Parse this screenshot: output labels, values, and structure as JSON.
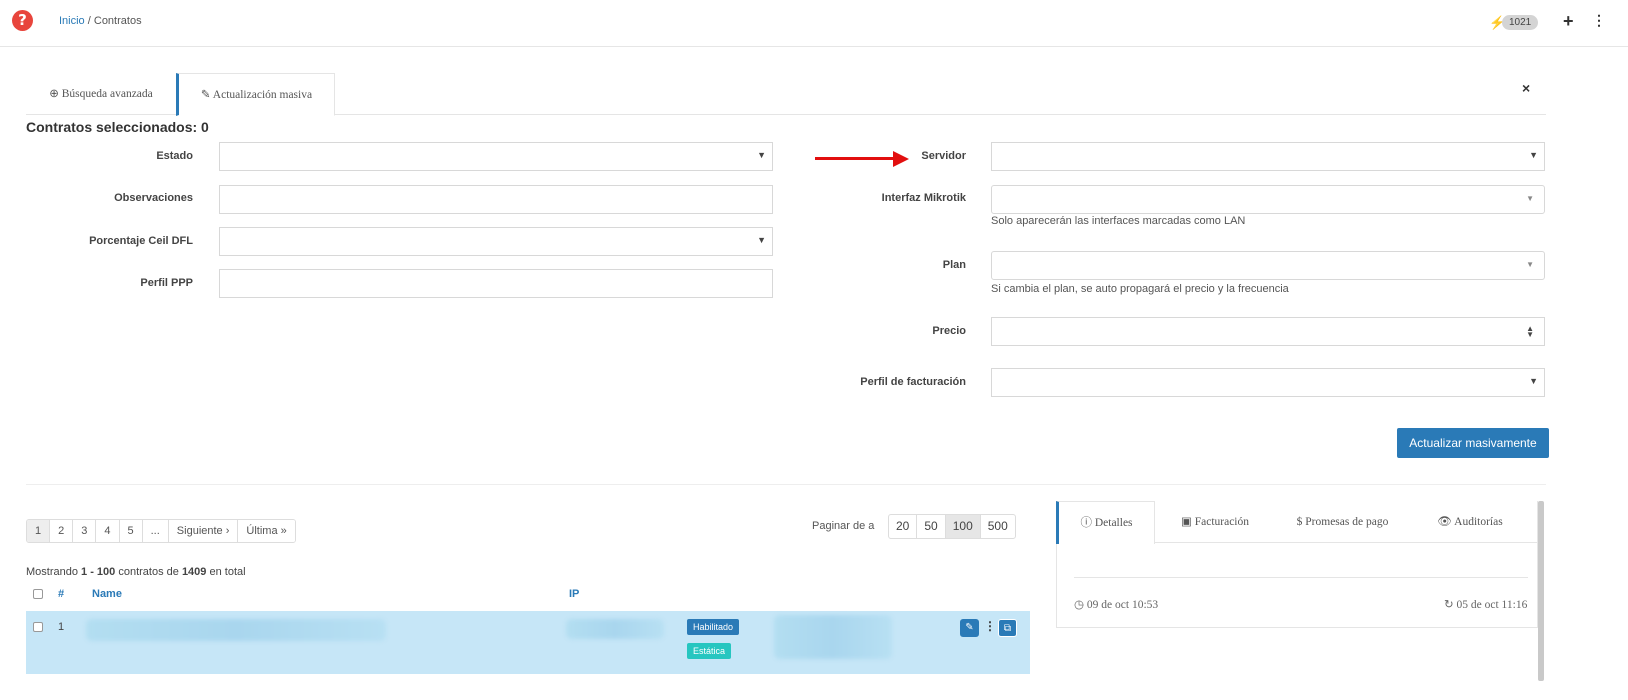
{
  "header": {
    "help_icon": "question-circle-icon",
    "breadcrumb_home": "Inicio",
    "breadcrumb_sep": "/",
    "breadcrumb_current": "Contratos",
    "connection_count": "1021"
  },
  "tabs": {
    "advanced_search": "Búsqueda avanzada",
    "bulk_update": "Actualización masiva",
    "close": "×"
  },
  "form": {
    "selected_label": "Contratos seleccionados: 0",
    "estado": "Estado",
    "observaciones": "Observaciones",
    "porcentaje": "Porcentaje Ceil DFL",
    "perfil_ppp": "Perfil PPP",
    "servidor": "Servidor",
    "interfaz": "Interfaz Mikrotik",
    "interfaz_help": "Solo aparecerán las interfaces marcadas como LAN",
    "plan": "Plan",
    "plan_help": "Si cambia el plan, se auto propagará el precio y la frecuencia",
    "precio": "Precio",
    "perfil_fact": "Perfil de facturación",
    "submit": "Actualizar masivamente"
  },
  "pagination": {
    "pages": [
      "1",
      "2",
      "3",
      "4",
      "5",
      "...",
      "Siguiente ›",
      "Última »"
    ],
    "active_page": "1",
    "per_page_label": "Paginar de a",
    "per_page_options": [
      "20",
      "50",
      "100",
      "500"
    ],
    "per_page_selected": "100"
  },
  "table": {
    "showing_prefix": "Mostrando ",
    "showing_range": "1 - 100",
    "showing_mid": " contratos de ",
    "showing_total": "1409",
    "showing_suffix": " en total",
    "col_num": "#",
    "col_name": "Name",
    "col_ip": "IP",
    "row1_num": "1",
    "row1_status": "Habilitado",
    "row1_type": "Estática"
  },
  "side_panel": {
    "tab_detalles": "Detalles",
    "tab_facturacion": "Facturación",
    "tab_promesas": "Promesas de pago",
    "tab_auditorias": "Auditorías",
    "created": "09 de oct 10:53",
    "updated": "05 de oct 11:16"
  },
  "colors": {
    "accent": "#2a7ab7",
    "teal": "#26c6c0",
    "help_red": "#e8453c",
    "annotation_arrow": "#e20f0f"
  }
}
